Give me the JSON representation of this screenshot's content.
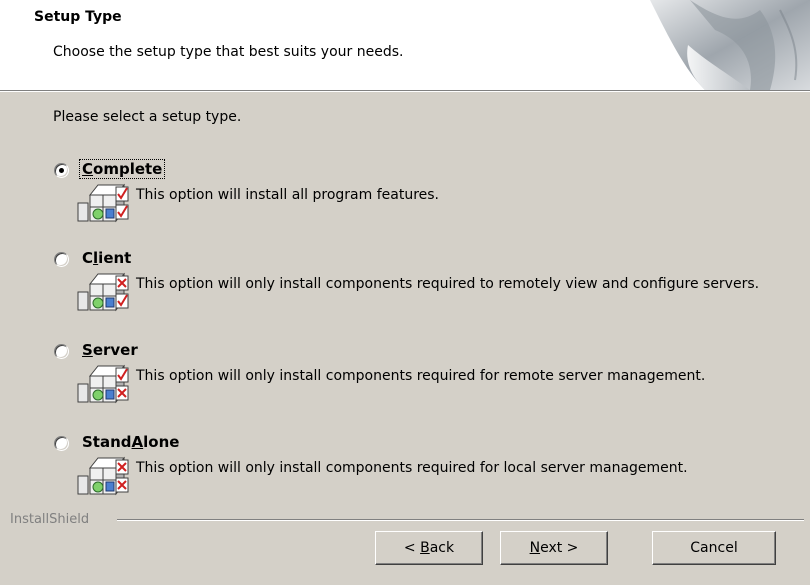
{
  "header": {
    "title": "Setup Type",
    "subtitle": "Choose the setup type that best suits your needs."
  },
  "prompt": "Please select a setup type.",
  "options": [
    {
      "label_pre": "",
      "label_key": "C",
      "label_post": "omplete",
      "description": "This option will install all program features.",
      "checked": true,
      "icon": "setup-components-icon"
    },
    {
      "label_pre": "C",
      "label_key": "l",
      "label_post": "ient",
      "description": "This option will only install components required to remotely view and configure servers.",
      "checked": false,
      "icon": "setup-components-icon"
    },
    {
      "label_pre": "",
      "label_key": "S",
      "label_post": "erver",
      "description": "This option will only install components required for remote server management.",
      "checked": false,
      "icon": "setup-components-icon"
    },
    {
      "label_pre": "Stand",
      "label_key": "A",
      "label_post": "lone",
      "description": "This option will only install components required for local server management.",
      "checked": false,
      "icon": "setup-components-icon"
    }
  ],
  "footer": {
    "brand": "InstallShield",
    "back_pre": "< ",
    "back_key": "B",
    "back_post": "ack",
    "next_key": "N",
    "next_post": "ext >",
    "cancel": "Cancel"
  }
}
